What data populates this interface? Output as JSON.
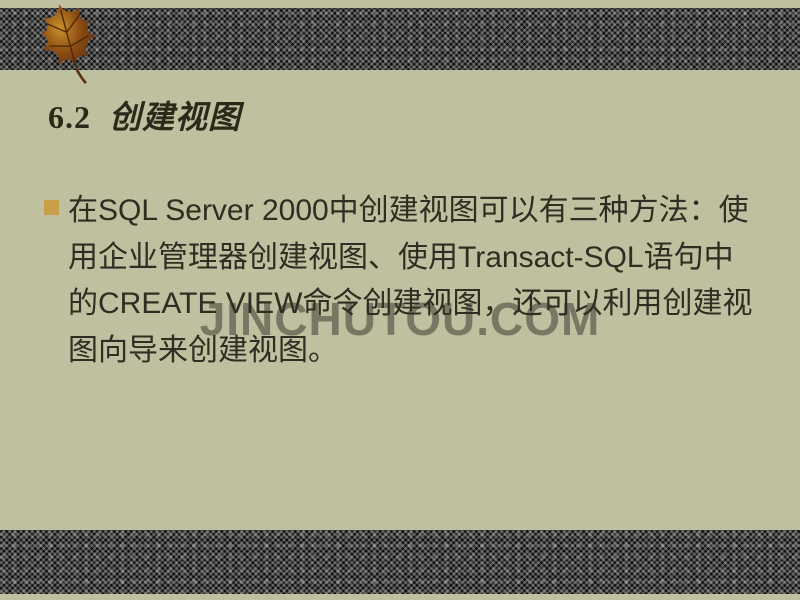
{
  "heading": {
    "number": "6.2",
    "title": "创建视图"
  },
  "bullet_color": "#c9a04a",
  "paragraph": "在SQL Server 2000中创建视图可以有三种方法：使用企业管理器创建视图、使用Transact-SQL语句中的CREATE VIEW命令创建视图，还可以利用创建视图向导来创建视图。",
  "watermark": "JINCHUTOU.COM"
}
